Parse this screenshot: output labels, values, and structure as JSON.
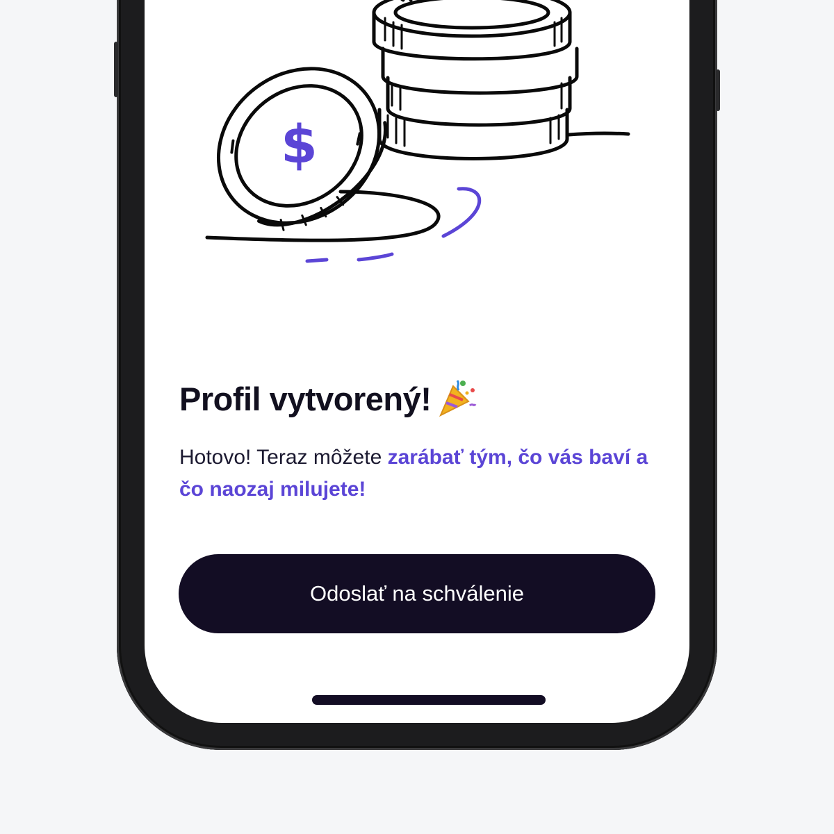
{
  "onboarding": {
    "title": "Profil vytvorený!",
    "title_emoji": "party-popper-icon",
    "description_plain": "Hotovo! Teraz môžete ",
    "description_highlight": "zarábať tým, čo vás baví a čo naozaj milujete!",
    "submit_label": "Odoslať na schválenie"
  },
  "illustration": {
    "name": "coins-stack-illustration",
    "symbol": "$"
  },
  "colors": {
    "accent": "#5b45d6",
    "dark": "#130d24",
    "page_background": "#f5f6f8",
    "screen_background": "#ffffff",
    "phone_frame": "#1c1c1e"
  }
}
